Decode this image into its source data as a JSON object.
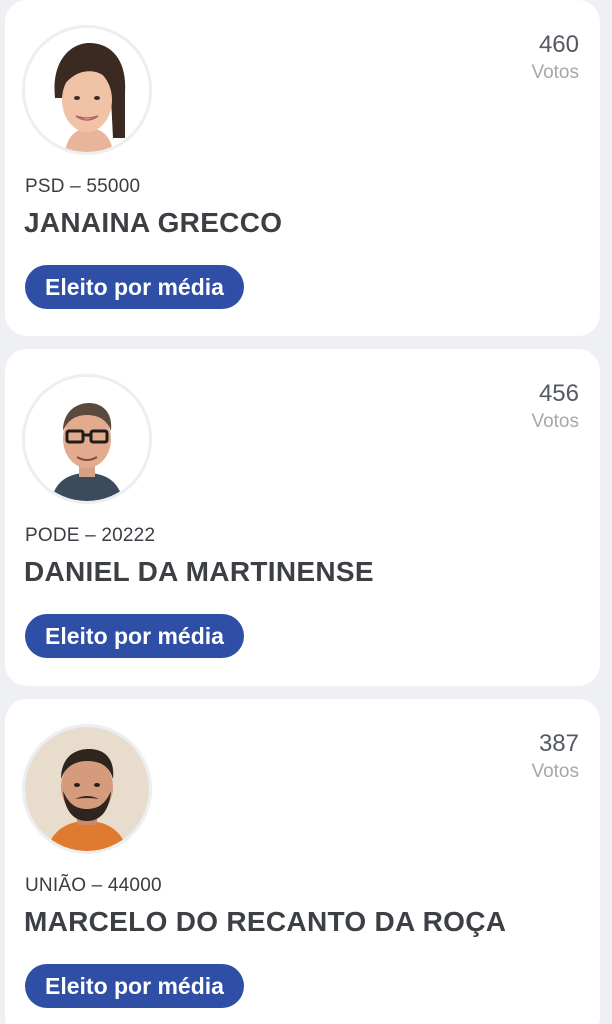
{
  "candidates": [
    {
      "votes": "460",
      "votes_label": "Votos",
      "party": "PSD – 55000",
      "name": "JANAINA GRECCO",
      "status": "Eleito por média"
    },
    {
      "votes": "456",
      "votes_label": "Votos",
      "party": "PODE – 20222",
      "name": "DANIEL DA MARTINENSE",
      "status": "Eleito por média"
    },
    {
      "votes": "387",
      "votes_label": "Votos",
      "party": "UNIÃO – 44000",
      "name": "MARCELO DO RECANTO DA ROÇA",
      "status": "Eleito por média"
    }
  ],
  "colors": {
    "badge": "#2f4ea6",
    "card": "#ffffff",
    "background": "#eef0f3"
  }
}
